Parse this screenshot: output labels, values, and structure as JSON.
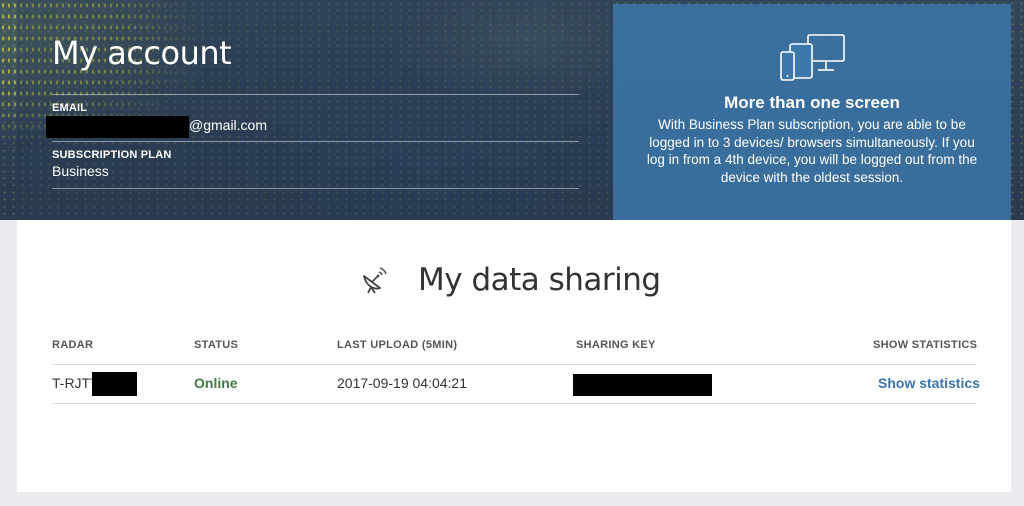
{
  "account": {
    "title": "My account",
    "email_label": "EMAIL",
    "email_suffix": "@gmail.com",
    "plan_label": "SUBSCRIPTION PLAN",
    "plan_value": "Business"
  },
  "promo": {
    "icon": "devices-icon",
    "title": "More than one screen",
    "text": "With Business Plan subscription, you are able to be logged in to 3 devices/ browsers simultaneously. If you log in from a 4th device, you will be logged out from the device with the oldest session."
  },
  "sharing": {
    "icon": "radar-dish-icon",
    "title": "My data sharing",
    "columns": [
      "RADAR",
      "STATUS",
      "LAST UPLOAD (5MIN)",
      "SHARING KEY",
      "SHOW STATISTICS"
    ],
    "rows": [
      {
        "radar": "T-RJTT",
        "status": "Online",
        "last_upload": "2017-09-19 04:04:21",
        "show_statistics": "Show statistics"
      }
    ]
  },
  "colors": {
    "hero_background": "#2d3f55",
    "promo_background": "#3c78ac",
    "status_online": "#3d7a45",
    "link": "#3a75ad"
  }
}
